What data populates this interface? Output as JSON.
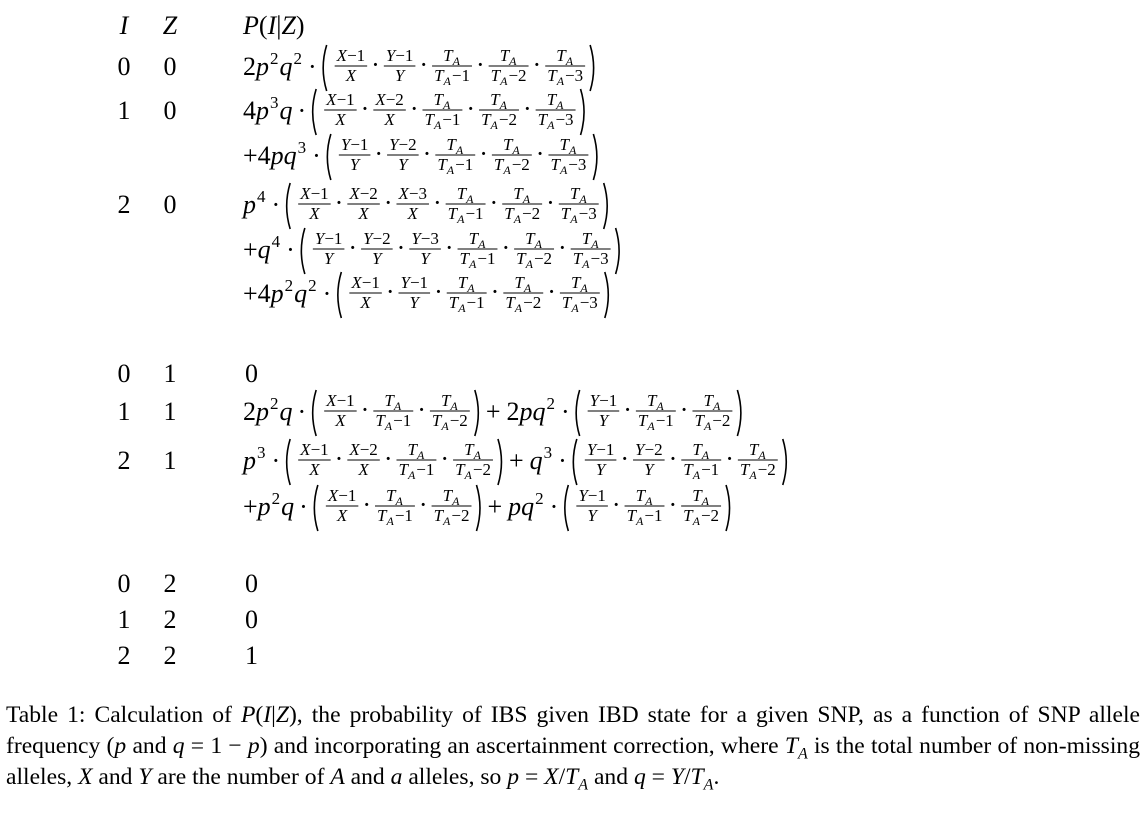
{
  "table": {
    "header": {
      "i": "I",
      "z": "Z",
      "p": "P(I|Z)"
    },
    "rows": [
      {
        "i": "0",
        "z": "0",
        "expr": "2p^2q^2 · ((X−1)/X · (Y−1)/Y · T_A/(T_A−1) · T_A/(T_A−2) · T_A/(T_A−3))"
      },
      {
        "i": "1",
        "z": "0",
        "expr": "4p^3q · ((X−1)/X · (X−2)/X · T_A/(T_A−1) · T_A/(T_A−2) · T_A/(T_A−3)) +4pq^3 · ((Y−1)/Y · (Y−2)/Y · T_A/(T_A−1) · T_A/(T_A−2) · T_A/(T_A−3))"
      },
      {
        "i": "2",
        "z": "0",
        "expr": "p^4 · ((X−1)/X · (X−2)/X · (X−3)/X · T_A/(T_A−1) · T_A/(T_A−2) · T_A/(T_A−3)) +q^4 · ((Y−1)/Y · (Y−2)/Y · (Y−3)/Y · T_A/(T_A−1) · T_A/(T_A−2) · T_A/(T_A−3)) +4p^2q^2 · ((X−1)/X · (Y−1)/Y · T_A/(T_A−1) · T_A/(T_A−2) · T_A/(T_A−3))"
      },
      {
        "i": "0",
        "z": "1",
        "expr": "0"
      },
      {
        "i": "1",
        "z": "1",
        "expr": "2p^2q · ((X−1)/X · T_A/(T_A−1) · T_A/(T_A−2)) + 2pq^2 · ((Y−1)/Y · T_A/(T_A−1) · T_A/(T_A−2))"
      },
      {
        "i": "2",
        "z": "1",
        "expr": "p^3 · ((X−1)/X · (X−2)/X · T_A/(T_A−1) · T_A/(T_A−2)) + q^3 · ((Y−1)/Y · (Y−2)/Y · T_A/(T_A−1) · T_A/(T_A−2)) +p^2q · ((X−1)/X · T_A/(T_A−1) · T_A/(T_A−2)) + pq^2 · ((Y−1)/Y · T_A/(T_A−1) · T_A/(T_A−2))"
      },
      {
        "i": "0",
        "z": "2",
        "expr": "0"
      },
      {
        "i": "1",
        "z": "2",
        "expr": "0"
      },
      {
        "i": "2",
        "z": "2",
        "expr": "1"
      }
    ]
  },
  "caption": {
    "label": "Table 1:",
    "text": "Calculation of P(I|Z), the probability of IBS given IBD state for a given SNP, as a function of SNP allele frequency (p and q = 1 − p) and incorporating an ascertainment correction, where T_A is the total number of non-missing alleles, X and Y are the number of A and a alleles, so p = X/T_A and q = Y/T_A."
  }
}
